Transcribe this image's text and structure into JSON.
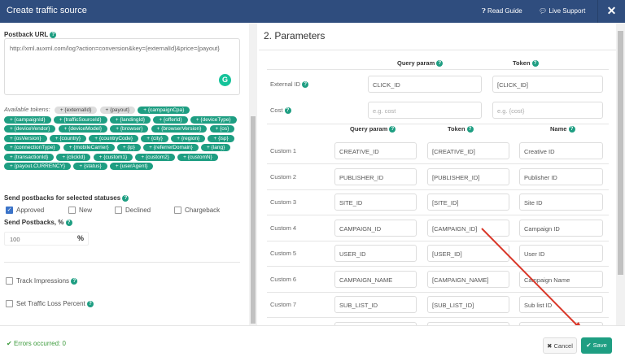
{
  "header": {
    "title": "Create traffic source",
    "read_guide": "Read Guide",
    "live_support": "Live Support",
    "close": "✕"
  },
  "left": {
    "postback_label": "Postback URL",
    "postback_value": "http://xml.auxml.com/log?action=conversion&key={externalId}&price={payout}",
    "available_tokens_label": "Available tokens:",
    "tokens_grey": [
      "+ {externalId}",
      "+ {payout}"
    ],
    "tokens": [
      "+ {campaignCpa}",
      "+ {campaignId}",
      "+ {trafficSourceId}",
      "+ {landingId}",
      "+ {offerId}",
      "+ {deviceType}",
      "+ {deviceVendor}",
      "+ {deviceModel}",
      "+ {browser}",
      "+ {browserVersion}",
      "+ {os}",
      "+ {osVersion}",
      "+ {country}",
      "+ {countryCode}",
      "+ {city}",
      "+ {region}",
      "+ {isp}",
      "+ {connectionType}",
      "+ {mobileCarrier}",
      "+ {ip}",
      "+ {referrerDomain}",
      "+ {lang}",
      "+ {transactionId}",
      "+ {clickId}",
      "+ {custom1}",
      "+ {custom2}",
      "+ {customN}",
      "+ {payout.CURRENCY}",
      "+ {status}",
      "+ {userAgent}"
    ],
    "statuses_label": "Send postbacks for selected statuses",
    "statuses": [
      {
        "label": "Approved",
        "checked": true
      },
      {
        "label": "New",
        "checked": false
      },
      {
        "label": "Declined",
        "checked": false
      },
      {
        "label": "Chargeback",
        "checked": false
      }
    ],
    "send_pct_label": "Send Postbacks, %",
    "send_pct_value": "100",
    "pct_symbol": "%",
    "track_impressions": "Track Impressions",
    "traffic_loss": "Set Traffic Loss Percent"
  },
  "right": {
    "title": "2. Parameters",
    "col_query": "Query param",
    "col_token": "Token",
    "col_name": "Name",
    "external_id": {
      "label": "External ID",
      "query": "CLICK_ID",
      "token": "[CLICK_ID]"
    },
    "cost": {
      "label": "Cost",
      "query_placeholder": "e.g. cost",
      "token_placeholder": "e.g. {cost}"
    },
    "customs": [
      {
        "label": "Custom 1",
        "query": "CREATIVE_ID",
        "token": "[CREATIVE_ID]",
        "name": "Creative ID"
      },
      {
        "label": "Custom 2",
        "query": "PUBLISHER_ID",
        "token": "[PUBLISHER_ID]",
        "name": "Publisher ID"
      },
      {
        "label": "Custom 3",
        "query": "SITE_ID",
        "token": "[SITE_ID]",
        "name": "Site ID"
      },
      {
        "label": "Custom 4",
        "query": "CAMPAIGN_ID",
        "token": "[CAMPAIGN_ID]",
        "name": "Campaign ID"
      },
      {
        "label": "Custom 5",
        "query": "USER_ID",
        "token": "[USER_ID]",
        "name": "User ID"
      },
      {
        "label": "Custom 6",
        "query": "CAMPAIGN_NAME",
        "token": "[CAMPAIGN_NAME]",
        "name": "Campaign Name"
      },
      {
        "label": "Custom 7",
        "query": "SUB_LIST_ID",
        "token": "[SUB_LIST_ID]",
        "name": "Sub list ID"
      }
    ]
  },
  "footer": {
    "errors": "Errors occurred: 0",
    "cancel": "Cancel",
    "save": "Save"
  },
  "colors": {
    "header": "#2f4d7e",
    "accent": "#1e9e82",
    "arrow": "#d9382a"
  }
}
